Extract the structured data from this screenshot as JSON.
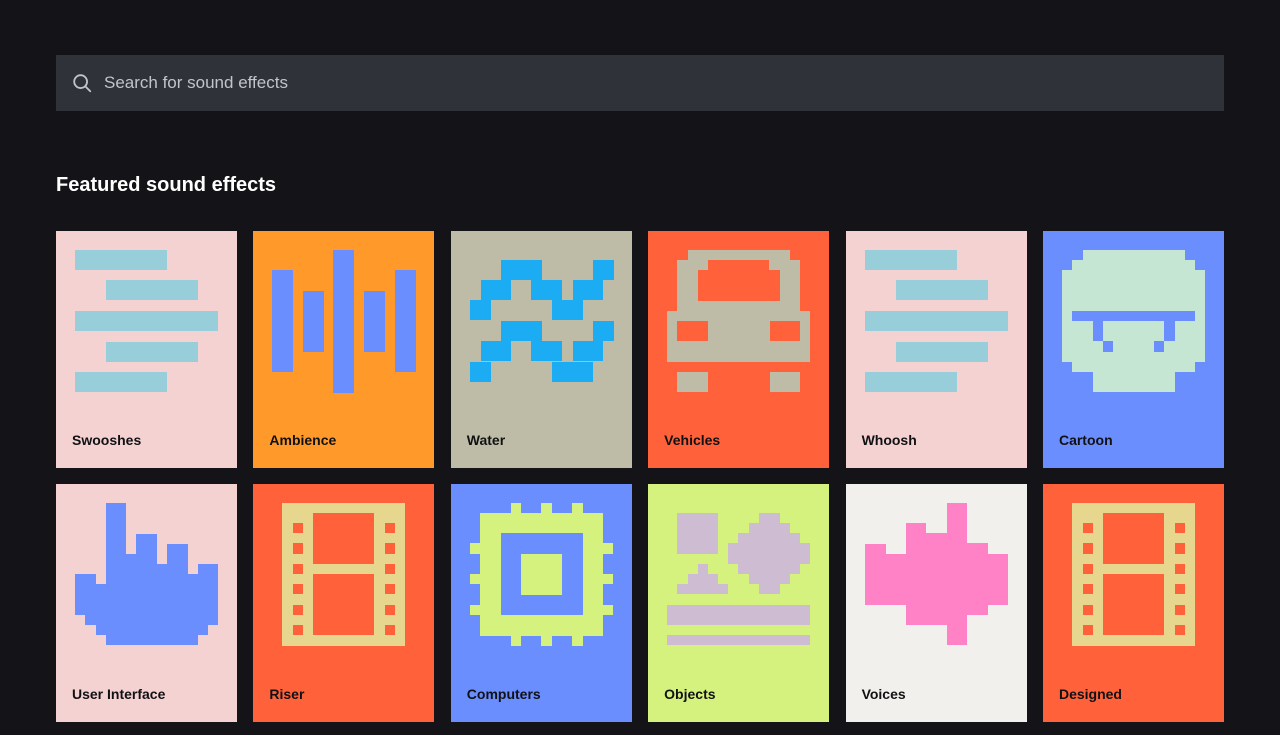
{
  "search": {
    "placeholder": "Search for sound effects",
    "icon": "search-icon"
  },
  "featured": {
    "title": "Featured sound effects",
    "cards": [
      {
        "label": "Swooshes",
        "bg": "#f4d2d2",
        "fg": "#97ceda",
        "icon": "swoosh-bars-icon"
      },
      {
        "label": "Ambience",
        "bg": "#ff9a2a",
        "fg": "#6b8eff",
        "icon": "soundwave-icon"
      },
      {
        "label": "Water",
        "bg": "#bebca6",
        "fg": "#1cacf4",
        "icon": "wave-icon"
      },
      {
        "label": "Vehicles",
        "bg": "#ff623a",
        "fg": "#bebca6",
        "icon": "car-icon"
      },
      {
        "label": "Whoosh",
        "bg": "#f4d2d2",
        "fg": "#97ceda",
        "icon": "swoosh-bars-icon"
      },
      {
        "label": "Cartoon",
        "bg": "#6b8eff",
        "fg": "#c6e6d4",
        "icon": "smile-face-icon"
      },
      {
        "label": "User Interface",
        "bg": "#f4d2d2",
        "fg": "#6b8eff",
        "icon": "pointer-hand-icon"
      },
      {
        "label": "Riser",
        "bg": "#ff623a",
        "fg": "#e6d68e",
        "icon": "film-strip-icon"
      },
      {
        "label": "Computers",
        "bg": "#6b8eff",
        "fg": "#d6f27e",
        "icon": "chip-icon"
      },
      {
        "label": "Objects",
        "bg": "#d6f27e",
        "fg": "#cebcd2",
        "icon": "shapes-icon"
      },
      {
        "label": "Voices",
        "bg": "#f2f0ec",
        "fg": "#ff82c6",
        "icon": "voice-burst-icon"
      },
      {
        "label": "Designed",
        "bg": "#ff623a",
        "fg": "#e6d68e",
        "icon": "film-strip-icon"
      }
    ]
  }
}
